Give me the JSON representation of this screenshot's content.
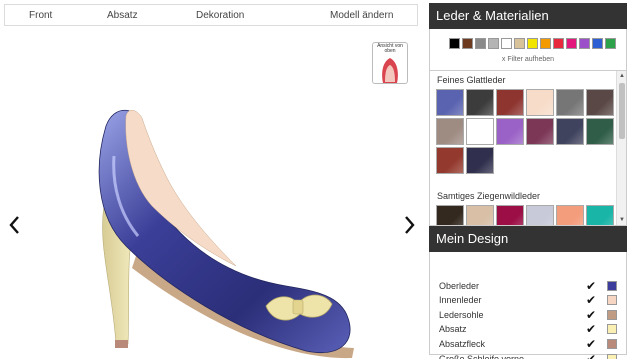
{
  "tabs": [
    "Front",
    "Absatz",
    "Dekoration",
    "Modell ändern"
  ],
  "nav": {
    "prev_icon": "chevron-left-icon",
    "next_icon": "chevron-right-icon"
  },
  "top_view": {
    "label": "Ansicht von oben"
  },
  "materials": {
    "title": "Leder & Materialien",
    "color_filters": [
      "#000000",
      "#6b3a1f",
      "#8a8a8a",
      "#b5b5b5",
      "#ffffff",
      "#d8c29a",
      "#f2e600",
      "#f29a00",
      "#e8283c",
      "#e3197b",
      "#9b4fc9",
      "#2d5fd3",
      "#2ea24a"
    ],
    "clear_filter": "x Filter aufheben",
    "sections": [
      {
        "title": "Feines Glattleder",
        "colors": [
          "#5a63b0",
          "#3c3c3c",
          "#8e3530",
          "#f7dcc9",
          "#767676",
          "#5a4846",
          "#9e8b82",
          "#ffffff",
          "#9a62c6",
          "#7c3656",
          "#40435e",
          "#2f5d47",
          "#94392d",
          "#30304e"
        ]
      },
      {
        "title": "Samtiges Ziegenwildleder",
        "colors": [
          "#33291f",
          "#d8bfa6",
          "#9b0f46",
          "#c8c9d9",
          "#f49d7c",
          "#19b5a7"
        ]
      }
    ]
  },
  "my_design": {
    "title": "Mein Design",
    "items": [
      {
        "name": "Oberleder",
        "color": "#3d3d9e"
      },
      {
        "name": "Innenleder",
        "color": "#f7d7c3"
      },
      {
        "name": "Ledersohle",
        "color": "#c09c84"
      },
      {
        "name": "Absatz",
        "color": "#fbf0b4"
      },
      {
        "name": "Absatzfleck",
        "color": "#b9897a"
      },
      {
        "name": "Große Schleife vorne",
        "color": "#fbf0b4"
      }
    ]
  }
}
